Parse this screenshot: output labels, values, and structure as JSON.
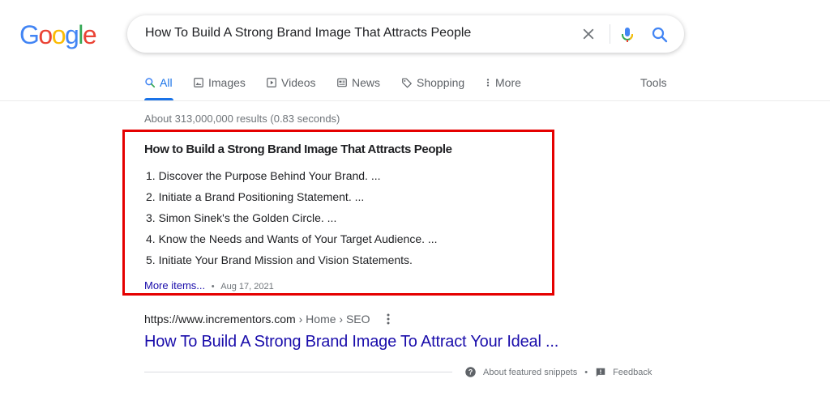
{
  "logo": {
    "letters": [
      "G",
      "o",
      "o",
      "g",
      "l",
      "e"
    ],
    "colors": [
      "#4285F4",
      "#EA4335",
      "#FBBC05",
      "#4285F4",
      "#34A853",
      "#EA4335"
    ]
  },
  "search": {
    "query": "How To Build A Strong Brand Image That Attracts People",
    "clear_icon": "close-icon",
    "mic_icon": "mic-icon",
    "search_icon": "search-icon"
  },
  "tabs": [
    {
      "label": "All",
      "icon": "search-icon",
      "active": true
    },
    {
      "label": "Images",
      "icon": "image-icon"
    },
    {
      "label": "Videos",
      "icon": "play-icon"
    },
    {
      "label": "News",
      "icon": "news-icon"
    },
    {
      "label": "Shopping",
      "icon": "tag-icon"
    },
    {
      "label": "More",
      "icon": "more-vert-icon"
    }
  ],
  "tools_label": "Tools",
  "result_stats": "About 313,000,000 results (0.83 seconds)",
  "snippet": {
    "title": "How to Build a Strong Brand Image That Attracts People",
    "items": [
      "1. Discover the Purpose Behind Your Brand. ...",
      "2. Initiate a Brand Positioning Statement. ...",
      "3. Simon Sinek's the Golden Circle. ...",
      "4. Know the Needs and Wants of Your Target Audience. ...",
      "5. Initiate Your Brand Mission and Vision Statements."
    ],
    "more_label": "More items...",
    "separator": "•",
    "date": "Aug 17, 2021",
    "highlight_color": "#e50000"
  },
  "result": {
    "url": "https://www.incrementors.com",
    "breadcrumb": " › Home › SEO",
    "title": "How To Build A Strong Brand Image To Attract Your Ideal ..."
  },
  "footer": {
    "about_label": "About featured snippets",
    "separator": "•",
    "feedback_label": "Feedback"
  },
  "colors": {
    "accent": "#1a73e8",
    "link": "#1a0dab",
    "muted": "#70757a"
  }
}
